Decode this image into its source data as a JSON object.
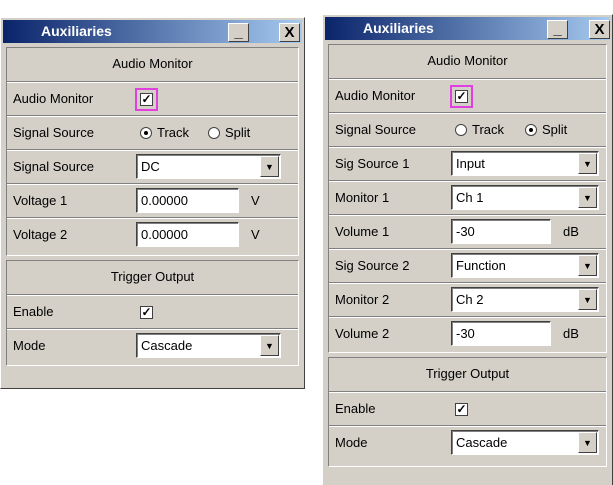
{
  "left": {
    "title": "Auxiliaries",
    "minimize": "_",
    "close": "X",
    "audio_monitor_header": "Audio Monitor",
    "audio_monitor_label": "Audio Monitor",
    "audio_monitor_checked": "✓",
    "signal_source_label": "Signal Source",
    "track_label": "Track",
    "split_label": "Split",
    "signal_source2_label": "Signal Source",
    "signal_source_value": "DC",
    "voltage1_label": "Voltage 1",
    "voltage1_value": "0.00000",
    "voltage1_unit": "V",
    "voltage2_label": "Voltage 2",
    "voltage2_value": "0.00000",
    "voltage2_unit": "V",
    "trigger_header": "Trigger Output",
    "enable_label": "Enable",
    "enable_checked": "✓",
    "mode_label": "Mode",
    "mode_value": "Cascade"
  },
  "right": {
    "title": "Auxiliaries",
    "minimize": "_",
    "close": "X",
    "audio_monitor_header": "Audio Monitor",
    "audio_monitor_label": "Audio Monitor",
    "audio_monitor_checked": "✓",
    "signal_source_label": "Signal Source",
    "track_label": "Track",
    "split_label": "Split",
    "sig_source1_label": "Sig Source 1",
    "sig_source1_value": "Input",
    "monitor1_label": "Monitor 1",
    "monitor1_value": "Ch 1",
    "volume1_label": "Volume 1",
    "volume1_value": "-30",
    "volume1_unit": "dB",
    "sig_source2_label": "Sig Source 2",
    "sig_source2_value": "Function",
    "monitor2_label": "Monitor 2",
    "monitor2_value": "Ch 2",
    "volume2_label": "Volume 2",
    "volume2_value": "-30",
    "volume2_unit": "dB",
    "trigger_header": "Trigger Output",
    "enable_label": "Enable",
    "enable_checked": "✓",
    "mode_label": "Mode",
    "mode_value": "Cascade"
  },
  "colors": {
    "titlebar": "#0a246a",
    "highlight": "#e040e0",
    "face": "#d4d0c8"
  }
}
